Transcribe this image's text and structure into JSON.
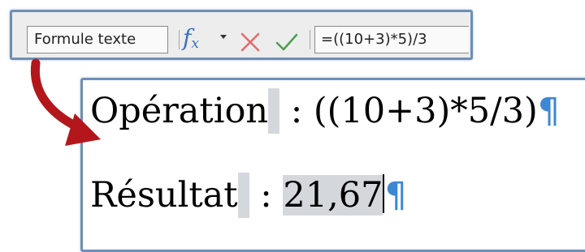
{
  "toolbar": {
    "name_box": "Formule texte",
    "formula": "=((10+3)*5)/3",
    "fx_symbol": "f",
    "fx_subscript": "x"
  },
  "document": {
    "line1": {
      "label": "Opération",
      "separator": " : ",
      "value": "((10+3)*5/3)"
    },
    "line2": {
      "label": "Résultat",
      "separator": " : ",
      "value": "21,67"
    },
    "pilcrow": "¶"
  },
  "colors": {
    "accent_border": "#6d8fb5",
    "arrow": "#b3161b",
    "cancel": "#e46a6a",
    "accept": "#4f9d4f",
    "pilcrow": "#3d87d4",
    "fx": "#3a6fc2"
  }
}
